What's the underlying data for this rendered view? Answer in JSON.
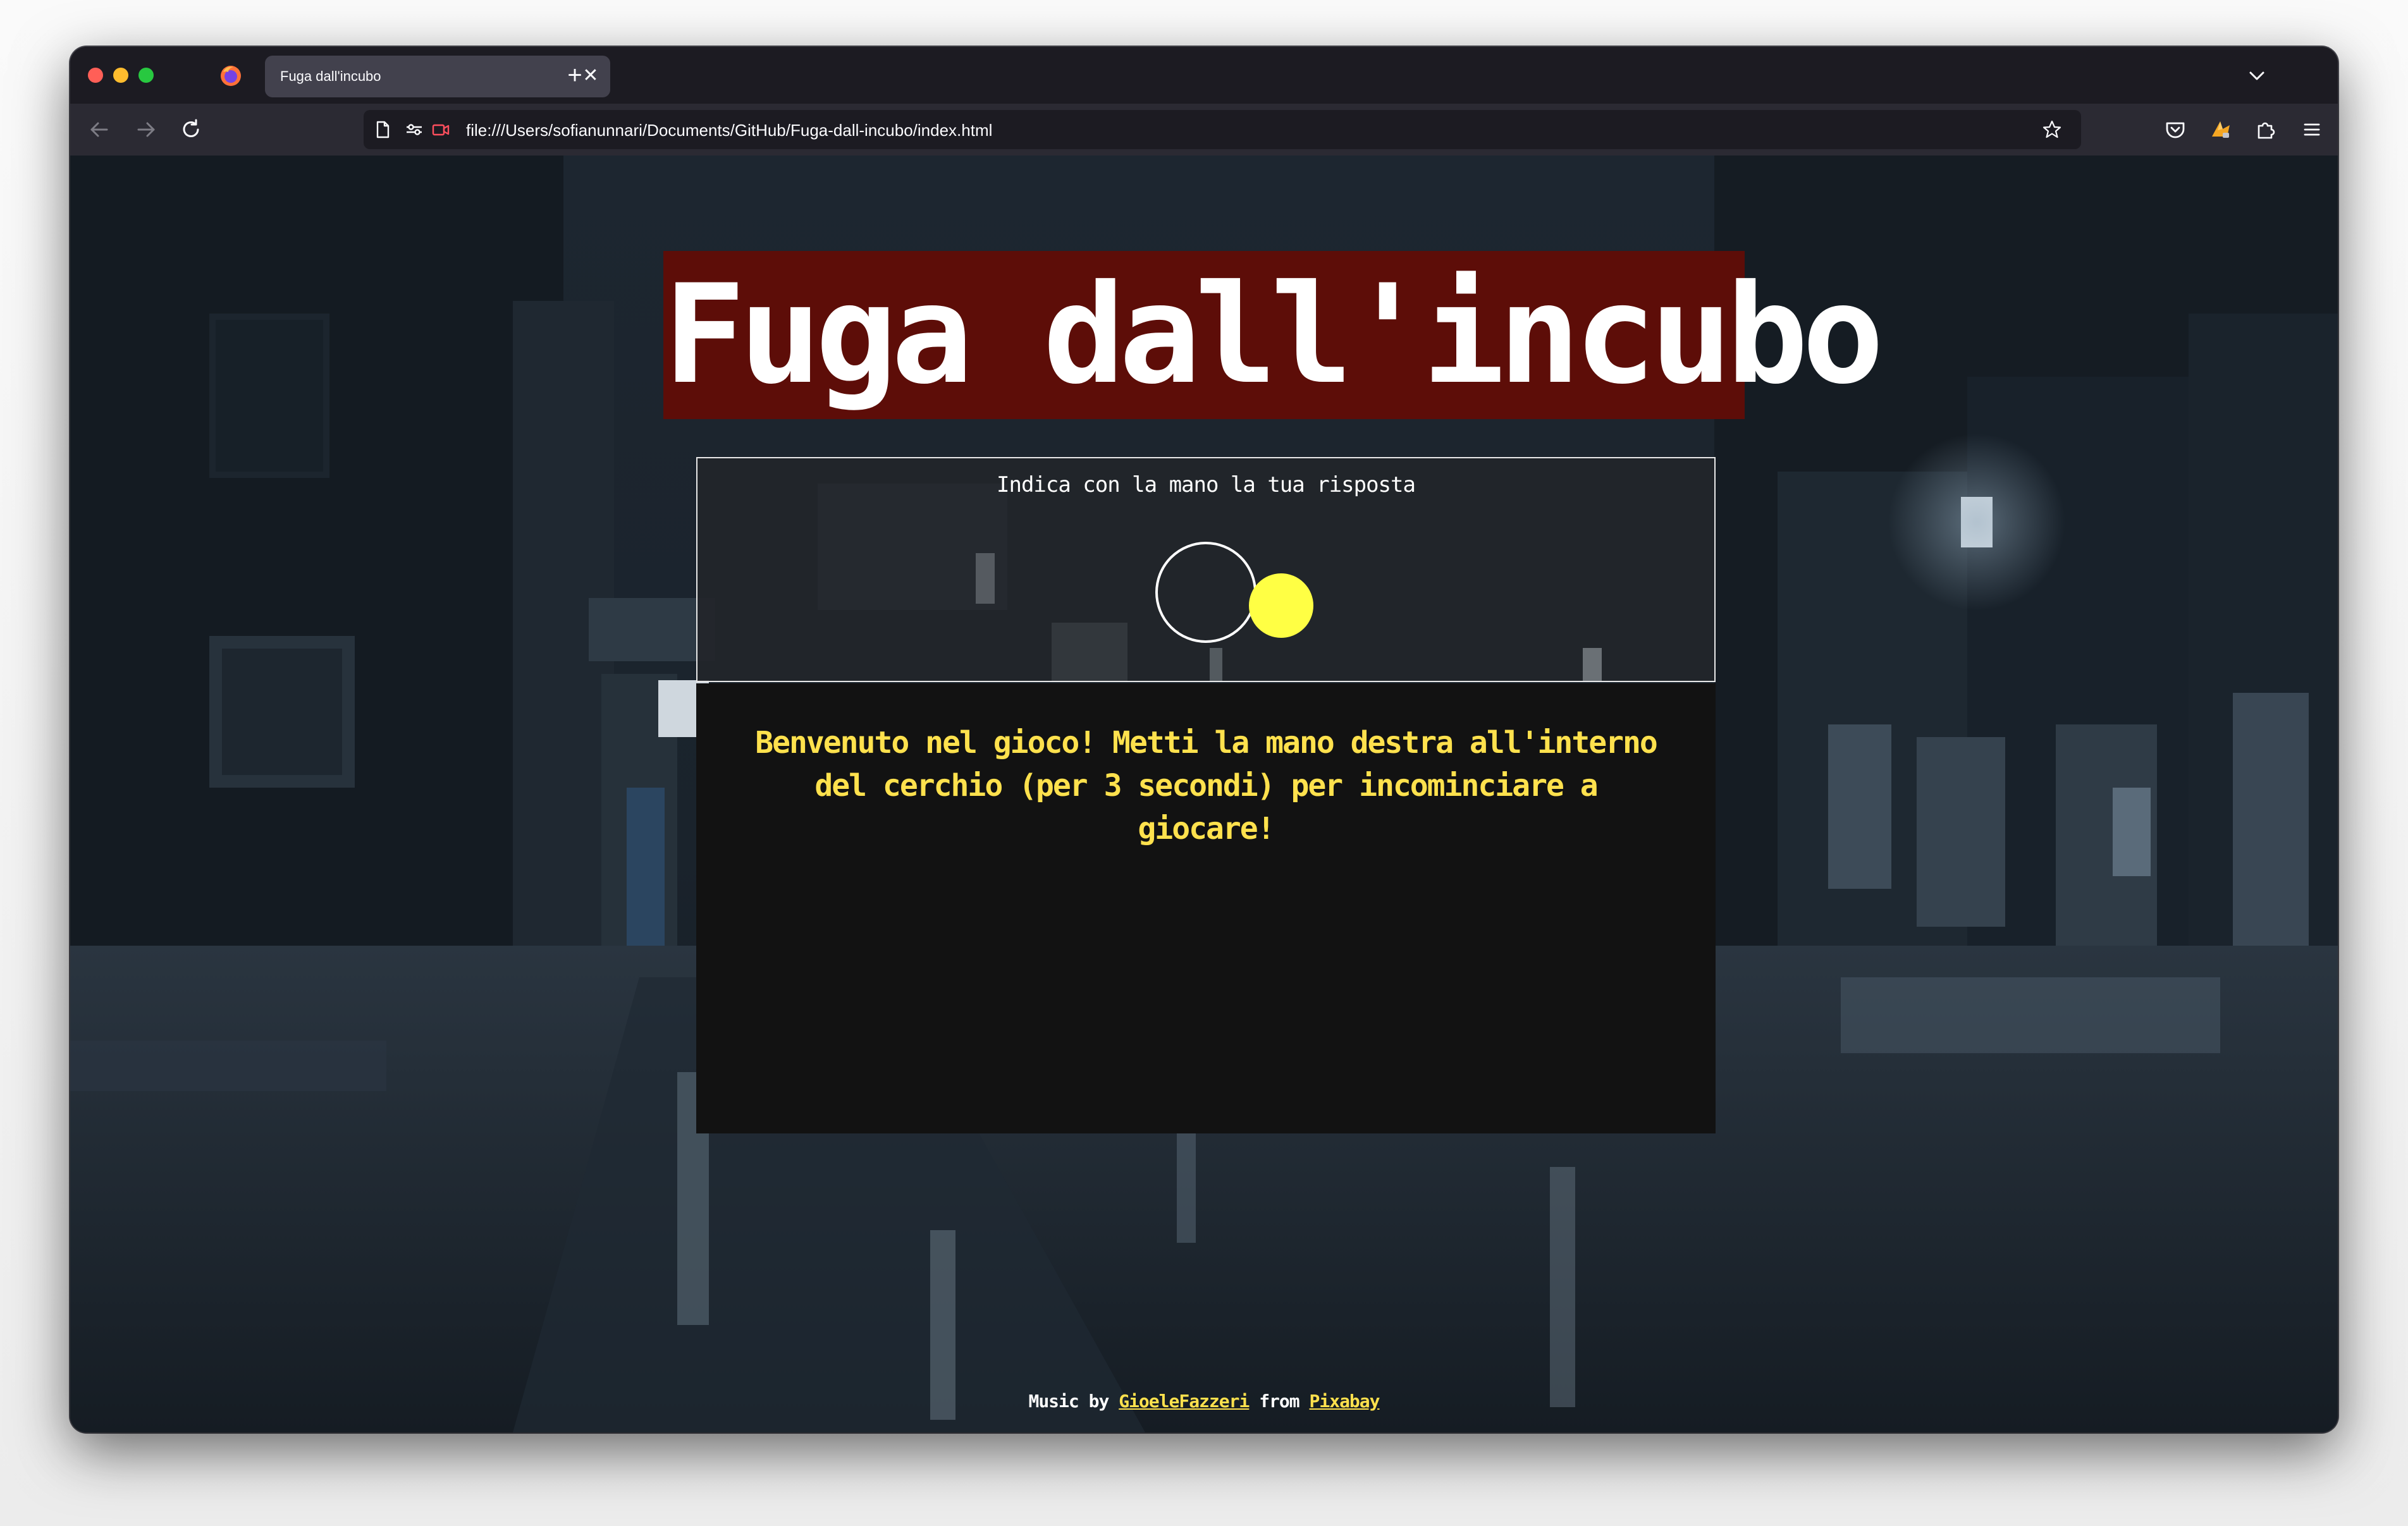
{
  "browser": {
    "tab": {
      "title": "Fuga dall'incubo",
      "close_glyph": "✕"
    },
    "new_tab_glyph": "+",
    "url": "file:///Users/sofianunnari/Documents/GitHub/Fuga-dall-incubo/index.html",
    "icons": {
      "browser_logo": "firefox-icon",
      "back": "back-arrow-icon",
      "forward": "forward-arrow-icon",
      "reload": "reload-icon",
      "page_info": "page-icon",
      "permissions": "permissions-icon",
      "camera_blocked": "camera-red-icon",
      "bookmark": "star-icon",
      "pocket": "pocket-icon",
      "extension_fox": "fox-extension-icon",
      "extensions": "puzzle-icon",
      "menu": "hamburger-icon",
      "tab_list": "chevron-down-icon"
    }
  },
  "page": {
    "title": "Fuga dall'incubo",
    "camera_prompt": "Indica con la mano la tua risposta",
    "message": "Benvenuto nel gioco! Metti la mano destra all'interno del cerchio (per 3 secondi) per incominciare a giocare!",
    "credits": {
      "prefix": "Music by",
      "artist": "GioeleFazzeri",
      "middle": "from",
      "source": "Pixabay"
    }
  },
  "colors": {
    "title_bg": "#5d0d08",
    "accent_yellow": "#ffe14d",
    "hand_dot": "#ffff44",
    "message_bg": "#121212"
  }
}
